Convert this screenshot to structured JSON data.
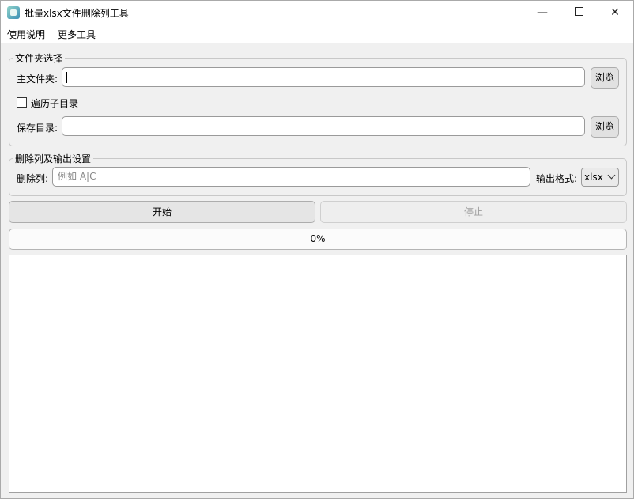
{
  "window": {
    "title": "批量xlsx文件删除列工具",
    "controls": {
      "minimize": "—",
      "close": "✕"
    }
  },
  "menu": {
    "items": [
      "使用说明",
      "更多工具"
    ]
  },
  "folder_group": {
    "title": "文件夹选择",
    "main_folder_label": "主文件夹:",
    "main_folder_value": "",
    "browse_label": "浏览",
    "recurse_label": "遍历子目录",
    "recurse_checked": false,
    "save_dir_label": "保存目录:",
    "save_dir_value": "",
    "browse2_label": "浏览"
  },
  "settings_group": {
    "title": "删除列及输出设置",
    "delete_cols_label": "删除列:",
    "delete_cols_placeholder": "例如 A|C",
    "format_label": "输出格式:",
    "format_value": "xlsx"
  },
  "actions": {
    "start_label": "开始",
    "stop_label": "停止",
    "stop_enabled": false
  },
  "progress": {
    "text": "0%",
    "value": 0
  },
  "log": {
    "text": ""
  },
  "colors": {
    "progress_fill": "#06b025",
    "background": "#f0f0f0"
  }
}
